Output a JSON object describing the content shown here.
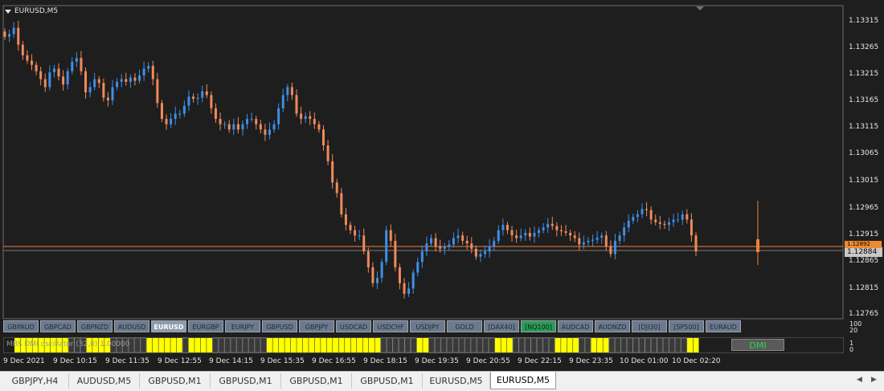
{
  "window": {
    "title": "EURUSD,M5"
  },
  "price_axis": {
    "ticks": [
      "1.13315",
      "1.13265",
      "1.13215",
      "1.13165",
      "1.13115",
      "1.13065",
      "1.13015",
      "1.12965",
      "1.12915",
      "1.12865",
      "1.12815",
      "1.12765"
    ],
    "current_bid": "1.12884",
    "current_ask": "1.12892"
  },
  "symbol_buttons": [
    {
      "label": "GBPAUD",
      "style": "normal"
    },
    {
      "label": "GBPCAD",
      "style": "normal"
    },
    {
      "label": "GBPNZD",
      "style": "normal"
    },
    {
      "label": "AUDUSD",
      "style": "normal"
    },
    {
      "label": "EURUSD",
      "style": "active"
    },
    {
      "label": "EURGBP",
      "style": "normal"
    },
    {
      "label": "EURJPY",
      "style": "normal"
    },
    {
      "label": "GBPUSD",
      "style": "normal"
    },
    {
      "label": "GBPJPY",
      "style": "normal"
    },
    {
      "label": "USDCAD",
      "style": "normal"
    },
    {
      "label": "USDCHF",
      "style": "normal"
    },
    {
      "label": "USDJPY",
      "style": "normal"
    },
    {
      "label": "GOLD",
      "style": "normal"
    },
    {
      "label": "[DAX40]",
      "style": "normal"
    },
    {
      "label": "[NQ100]",
      "style": "green"
    },
    {
      "label": "AUDCAD",
      "style": "normal"
    },
    {
      "label": "AUDNZD",
      "style": "normal"
    },
    {
      "label": "[DJI30]",
      "style": "normal"
    },
    {
      "label": "[SP500]",
      "style": "normal"
    },
    {
      "label": "EURAUD",
      "style": "normal"
    }
  ],
  "oscillator": {
    "label": "MBS DMI oscillator (32,0) 1.00000",
    "indicator_box": "DMI",
    "ticks": [
      "100",
      "20",
      "1",
      "0"
    ],
    "levels": [
      1,
      1,
      1,
      1,
      1,
      1,
      1,
      1,
      1,
      0,
      0,
      0,
      1,
      1,
      1,
      1,
      0,
      0,
      0,
      0,
      0,
      0,
      1,
      1,
      1,
      1,
      1,
      1,
      0,
      1,
      1,
      1,
      1,
      0,
      0,
      0,
      0,
      0,
      0,
      0,
      0,
      0,
      1,
      1,
      1,
      1,
      1,
      1,
      1,
      1,
      1,
      1,
      1,
      1,
      1,
      1,
      1,
      1,
      1,
      1,
      1,
      0,
      0,
      0,
      0,
      0,
      0,
      1,
      1,
      0,
      0,
      0,
      0,
      0,
      0,
      0,
      0,
      0,
      0,
      0,
      1,
      1,
      1,
      0,
      0,
      0,
      0,
      0,
      0,
      0,
      1,
      1,
      1,
      1,
      0,
      0,
      1,
      1,
      1,
      0,
      0,
      0,
      0,
      0,
      0,
      0,
      0,
      0,
      0,
      0,
      0,
      0,
      1,
      1
    ]
  },
  "time_axis": {
    "labels": [
      "9 Dec 2021",
      "9 Dec 10:15",
      "9 Dec 11:35",
      "9 Dec 12:55",
      "9 Dec 14:15",
      "9 Dec 15:35",
      "9 Dec 16:55",
      "9 Dec 18:15",
      "9 Dec 19:35",
      "9 Dec 20:55",
      "9 Dec 22:15",
      "9 Dec 23:35",
      "10 Dec 01:00",
      "10 Dec 02:20"
    ]
  },
  "tabs": [
    {
      "label": "GBPJPY,H4",
      "active": false
    },
    {
      "label": "AUDUSD,M5",
      "active": false
    },
    {
      "label": "GBPUSD,M1",
      "active": false
    },
    {
      "label": "GBPUSD,M1",
      "active": false
    },
    {
      "label": "GBPUSD,M1",
      "active": false
    },
    {
      "label": "GBPUSD,M1",
      "active": false
    },
    {
      "label": "EURUSD,M5",
      "active": false
    },
    {
      "label": "EURUSD,M5",
      "active": true
    }
  ],
  "chart_data": {
    "type": "candlestick",
    "symbol": "EURUSD",
    "timeframe": "M5",
    "closes": [
      1.13285,
      1.1329,
      1.13302,
      1.1327,
      1.1325,
      1.1324,
      1.13232,
      1.1322,
      1.13205,
      1.1319,
      1.13218,
      1.13225,
      1.1321,
      1.13195,
      1.1322,
      1.13238,
      1.13245,
      1.1322,
      1.1318,
      1.1319,
      1.13205,
      1.13198,
      1.1317,
      1.13165,
      1.1319,
      1.132,
      1.13205,
      1.132,
      1.13208,
      1.13202,
      1.13212,
      1.13225,
      1.1323,
      1.13205,
      1.1316,
      1.1313,
      1.1312,
      1.1313,
      1.1314,
      1.1314,
      1.13155,
      1.13172,
      1.13168,
      1.1317,
      1.13182,
      1.13175,
      1.1315,
      1.1313,
      1.1312,
      1.1312,
      1.1311,
      1.1312,
      1.1311,
      1.1312,
      1.1313,
      1.1313,
      1.1312,
      1.1311,
      1.131,
      1.1311,
      1.1312,
      1.1315,
      1.13175,
      1.1319,
      1.13175,
      1.1314,
      1.1313,
      1.13135,
      1.1313,
      1.1312,
      1.1311,
      1.1308,
      1.1305,
      1.1301,
      1.1299,
      1.1295,
      1.1293,
      1.1292,
      1.1291,
      1.1291,
      1.1288,
      1.1285,
      1.1282,
      1.1283,
      1.1286,
      1.1292,
      1.129,
      1.1285,
      1.1282,
      1.128,
      1.1281,
      1.1284,
      1.1286,
      1.1288,
      1.12895,
      1.12905,
      1.1289,
      1.12885,
      1.1289,
      1.12893,
      1.12905,
      1.1291,
      1.129,
      1.12895,
      1.12885,
      1.1287,
      1.12875,
      1.1288,
      1.1289,
      1.129,
      1.1292,
      1.1293,
      1.1292,
      1.1291,
      1.12905,
      1.1291,
      1.12915,
      1.12908,
      1.12915,
      1.1292,
      1.12925,
      1.12932,
      1.12928,
      1.1292,
      1.12918,
      1.12915,
      1.1291,
      1.12905,
      1.12893,
      1.12897,
      1.129,
      1.12902,
      1.12906,
      1.1291,
      1.1289,
      1.12875,
      1.129,
      1.1291,
      1.12925,
      1.12938,
      1.12945,
      1.1295,
      1.1296,
      1.12958,
      1.1294,
      1.12935,
      1.12932,
      1.1293,
      1.12935,
      1.1294,
      1.1294,
      1.1295,
      1.1294,
      1.1291,
      1.1288
    ]
  }
}
